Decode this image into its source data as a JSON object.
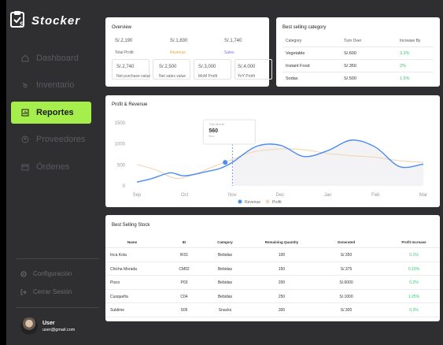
{
  "app": {
    "brand": "Stocker"
  },
  "sidebar": {
    "items": [
      {
        "label": "Dashboard",
        "icon": "home-icon"
      },
      {
        "label": "Inventario",
        "icon": "box-icon"
      },
      {
        "label": "Reportes",
        "icon": "report-icon",
        "active": true
      },
      {
        "label": "Proveedores",
        "icon": "supplier-icon"
      },
      {
        "label": "Órdenes",
        "icon": "orders-icon"
      }
    ],
    "settings": "Configuración",
    "logout": "Cerrar Sesión",
    "user": {
      "name": "User",
      "email": "user@gmail.com"
    },
    "accent": "#a6ee4c"
  },
  "overview": {
    "title": "Overview",
    "top": [
      {
        "value": "S/.2,190",
        "label": "Total Profit",
        "color": "#666666"
      },
      {
        "value": "S/.1,830",
        "label": "Revenue",
        "color": "#e8a33b"
      },
      {
        "value": "S/.1,740",
        "label": "Sales",
        "color": "#7a6ff0"
      }
    ],
    "bottom": [
      {
        "value": "S/.2,740",
        "label": "Net purchase value"
      },
      {
        "value": "S/.2,500",
        "label": "Net sales value"
      },
      {
        "value": "S/.3,000",
        "label": "MoM Profit"
      },
      {
        "value": "S/.4,000",
        "label": "YoY Profit"
      }
    ]
  },
  "best_category": {
    "title": "Best selling category",
    "headers": [
      "Category",
      "Turn Over",
      "Increase By"
    ],
    "rows": [
      [
        "Vegetable",
        "S/.600",
        "3.2%"
      ],
      [
        "Instant Food",
        "S/.350",
        "2%"
      ],
      [
        "Sodas",
        "S/.500",
        "1.5%"
      ]
    ]
  },
  "profit_chart": {
    "title": "Profit & Revenue",
    "tooltip": {
      "title": "This Month",
      "value": "560",
      "sub": "Nov"
    },
    "legend": [
      "Revenue",
      "Profit"
    ]
  },
  "chart_data": {
    "type": "line",
    "categories": [
      "Sep",
      "Oct",
      "Nov",
      "Dec",
      "Jan",
      "Feb",
      "Mar"
    ],
    "ylim": [
      0,
      1500
    ],
    "yticks": [
      0,
      500,
      1000,
      1500
    ],
    "series": [
      {
        "name": "Revenue",
        "color": "#4a8bf5",
        "x": [
          0,
          0.3,
          0.7,
          1,
          1.5,
          1.75,
          2,
          2.5,
          3,
          3.5,
          4,
          4.5,
          5,
          5.5,
          6
        ],
        "values": [
          90,
          170,
          310,
          240,
          350,
          420,
          560,
          940,
          970,
          700,
          840,
          1090,
          920,
          460,
          520
        ]
      },
      {
        "name": "Profit",
        "color": "#f1d9b6",
        "x": [
          0,
          0.4,
          0.8,
          1.2,
          1.6,
          2,
          2.4,
          3,
          3.5,
          4,
          4.5,
          5,
          5.5,
          6
        ],
        "values": [
          510,
          380,
          180,
          270,
          460,
          630,
          800,
          880,
          860,
          770,
          720,
          680,
          600,
          560
        ]
      }
    ]
  },
  "stock": {
    "title": "Best Selling Stock",
    "headers": [
      "Name",
      "ID",
      "Category",
      "Remaining Quantity",
      "Generated",
      "Profit Increase"
    ],
    "rows": [
      [
        "Inca Kola",
        "IK01",
        "Bebidas",
        "100",
        "S/.350",
        "0.1%"
      ],
      [
        "Chicha Morada",
        "CM02",
        "Bebidas",
        "150",
        "S/.375",
        "0.15%"
      ],
      [
        "Pisco",
        "P03",
        "Bebidas",
        "200",
        "S/.6000",
        "0.2%"
      ],
      [
        "Cusqueña",
        "C04",
        "Bebidas",
        "250",
        "S/.1000",
        "1.25%"
      ],
      [
        "Sublime",
        "S05",
        "Snacks",
        "300",
        "S/.300",
        "0.3%"
      ]
    ]
  }
}
